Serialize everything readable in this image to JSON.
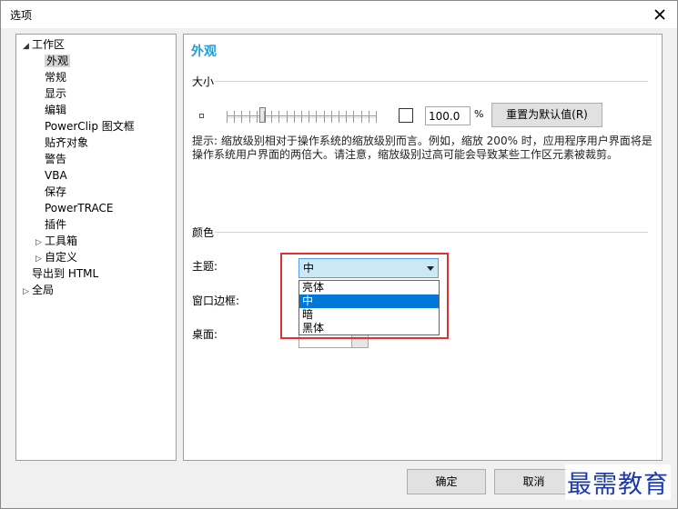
{
  "window": {
    "title": "选项"
  },
  "tree": {
    "items": [
      {
        "label": "工作区",
        "arrow": "◢",
        "level": 0
      },
      {
        "label": "外观",
        "arrow": "",
        "level": 1,
        "selected": true
      },
      {
        "label": "常规",
        "arrow": "",
        "level": 1
      },
      {
        "label": "显示",
        "arrow": "",
        "level": 1
      },
      {
        "label": "编辑",
        "arrow": "",
        "level": 1
      },
      {
        "label": "PowerClip 图文框",
        "arrow": "",
        "level": 1
      },
      {
        "label": "贴齐对象",
        "arrow": "",
        "level": 1
      },
      {
        "label": "警告",
        "arrow": "",
        "level": 1
      },
      {
        "label": "VBA",
        "arrow": "",
        "level": 1
      },
      {
        "label": "保存",
        "arrow": "",
        "level": 1
      },
      {
        "label": "PowerTRACE",
        "arrow": "",
        "level": 1
      },
      {
        "label": "插件",
        "arrow": "",
        "level": 1
      },
      {
        "label": "工具箱",
        "arrow": "▷",
        "level": 1
      },
      {
        "label": "自定义",
        "arrow": "▷",
        "level": 1
      },
      {
        "label": "导出到 HTML",
        "arrow": "",
        "level": 0
      },
      {
        "label": "全局",
        "arrow": "▷",
        "level": 0
      }
    ]
  },
  "panel": {
    "title": "外观",
    "size_group": {
      "label": "大小",
      "scale_value": "100.0",
      "percent": "%",
      "reset_button": "重置为默认值(R)",
      "hint": "提示: 缩放级别相对于操作系统的缩放级别而言。例如，缩放 200% 时，应用程序用户界面将是操作系统用户界面的两倍大。请注意，缩放级别过高可能会导致某些工作区元素被裁剪。"
    },
    "color_group": {
      "label": "颜色",
      "theme_label": "主题:",
      "theme_value": "中",
      "theme_options": [
        "亮体",
        "中",
        "暗",
        "黑体"
      ],
      "window_border_label": "窗口边框:",
      "desktop_label": "桌面:"
    }
  },
  "buttons": {
    "ok": "确定",
    "cancel": "取消"
  },
  "watermark": "最需教育",
  "colors": {
    "accent": "#1a9fd8",
    "selection": "#0078d7",
    "highlight_box": "#e03030"
  }
}
